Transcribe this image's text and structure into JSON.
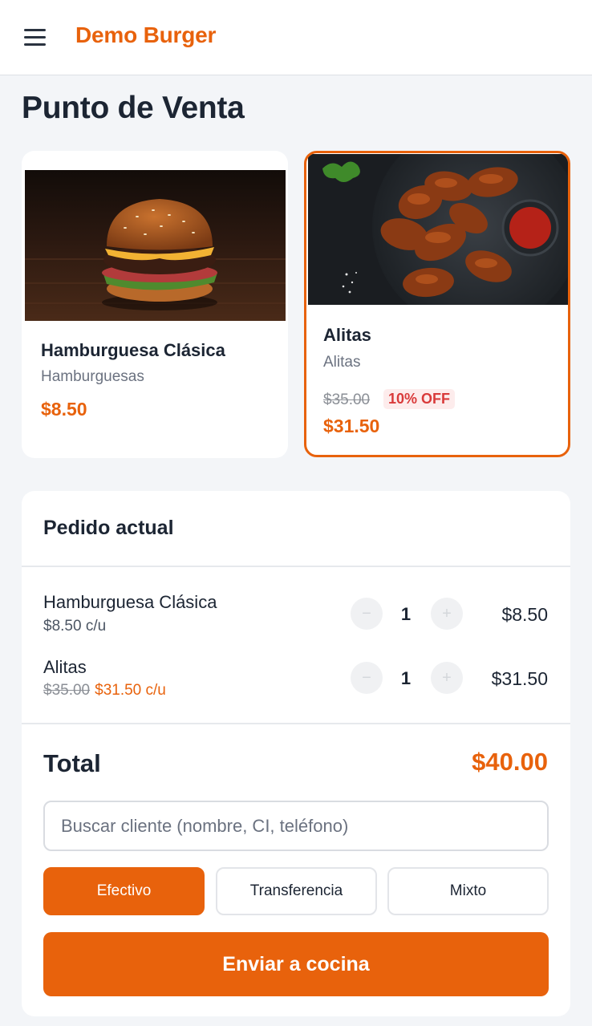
{
  "header": {
    "brand": "Demo Burger",
    "menu_icon": "hamburger-menu-icon"
  },
  "page": {
    "title": "Punto de Venta"
  },
  "products": [
    {
      "name": "Hamburguesa Clásica",
      "category": "Hamburguesas",
      "price": "$8.50",
      "image": "burger-photo"
    },
    {
      "name": "Alitas",
      "category": "Alitas",
      "old_price": "$35.00",
      "discount": "10% OFF",
      "price": "$31.50",
      "image": "chicken-wings-photo",
      "selected": true
    }
  ],
  "order": {
    "title": "Pedido actual",
    "items": [
      {
        "name": "Hamburguesa Clásica",
        "unit": "$8.50 c/u",
        "qty": "1",
        "total": "$8.50",
        "minus": "−",
        "plus": "+"
      },
      {
        "name": "Alitas",
        "old_unit": "$35.00",
        "unit": "$31.50 c/u",
        "qty": "1",
        "total": "$31.50",
        "minus": "−",
        "plus": "+"
      }
    ],
    "total_label": "Total",
    "total_value": "$40.00",
    "search_placeholder": "Buscar cliente (nombre, CI, teléfono)",
    "payment_methods": [
      "Efectivo",
      "Transferencia",
      "Mixto"
    ],
    "selected_payment": "Efectivo",
    "submit_label": "Enviar a cocina"
  },
  "colors": {
    "accent": "#e8620c",
    "discount_red": "#d93a3a",
    "background": "#f3f5f8"
  }
}
